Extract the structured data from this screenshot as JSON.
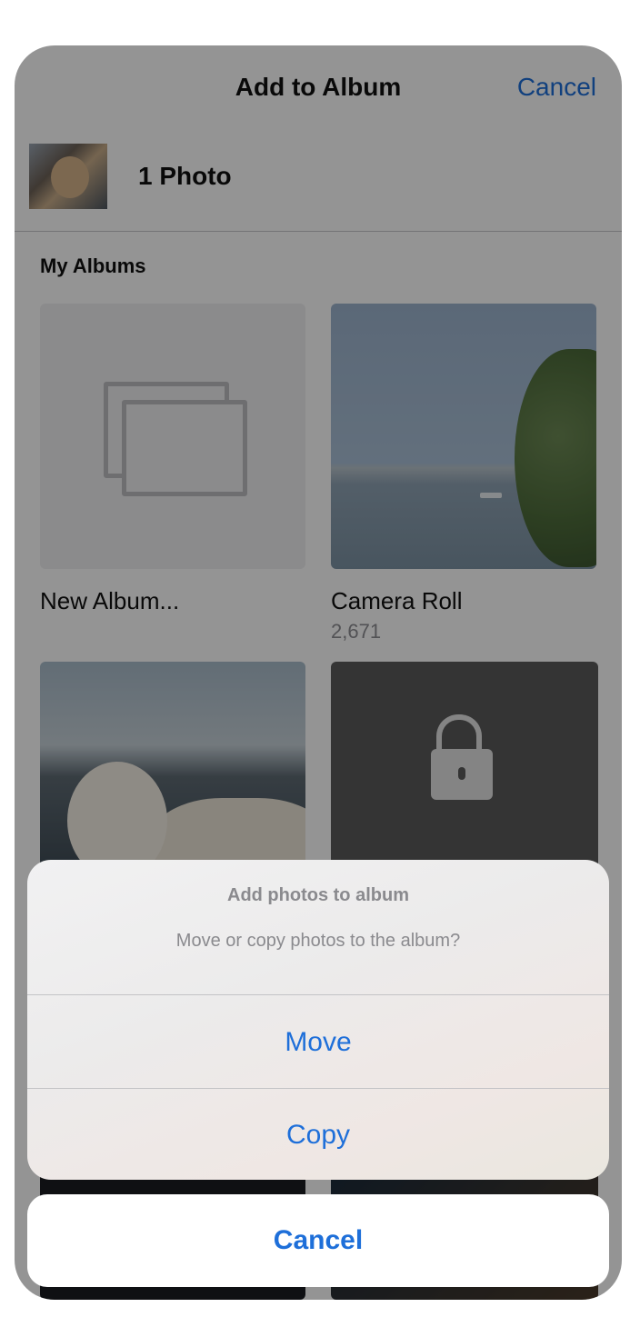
{
  "header": {
    "title": "Add to Album",
    "cancel_label": "Cancel"
  },
  "selection": {
    "count_label": "1 Photo"
  },
  "albums_section": {
    "label": "My Albums",
    "albums": [
      {
        "name": "New Album...",
        "count": ""
      },
      {
        "name": "Camera Roll",
        "count": "2,671"
      }
    ]
  },
  "action_sheet": {
    "title": "Add photos to album",
    "message": "Move or copy photos to the album?",
    "move_label": "Move",
    "copy_label": "Copy",
    "cancel_label": "Cancel"
  },
  "colors": {
    "accent": "#1e6fd9",
    "dim_overlay": "rgba(0,0,0,0.42)"
  },
  "icons": [
    "new-album-icon",
    "lock-icon"
  ]
}
